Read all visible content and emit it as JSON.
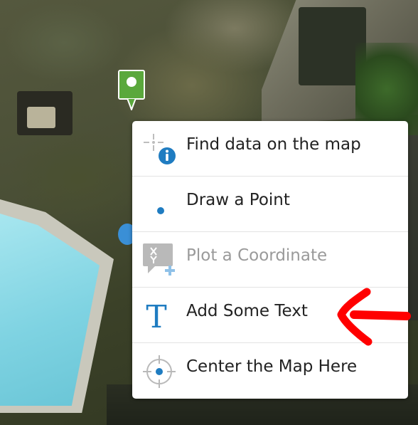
{
  "menu": {
    "items": [
      {
        "label": "Find data on the map",
        "icon": "find-data-icon",
        "enabled": true
      },
      {
        "label": "Draw a Point",
        "icon": "point-icon",
        "enabled": true
      },
      {
        "label": "Plot a Coordinate",
        "icon": "coordinate-icon",
        "enabled": false
      },
      {
        "label": "Add Some Text",
        "icon": "text-icon",
        "enabled": true
      },
      {
        "label": "Center the Map Here",
        "icon": "crosshair-icon",
        "enabled": true
      }
    ],
    "text_icon_glyph": "T",
    "coord_icon_x": "X",
    "coord_icon_y": "Y"
  },
  "colors": {
    "accent": "#1f7cc1",
    "marker": "#5aa83c",
    "annotation_arrow": "#ff0000",
    "disabled": "#9a9a9a"
  }
}
